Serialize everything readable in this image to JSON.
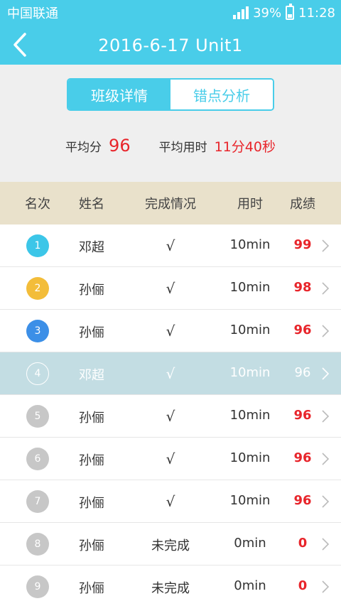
{
  "status_bar": {
    "carrier": "中国联通",
    "battery": "39%",
    "time": "11:28"
  },
  "nav": {
    "title": "2016-6-17 Unit1"
  },
  "tabs": [
    {
      "label": "班级详情",
      "active": true
    },
    {
      "label": "错点分析",
      "active": false
    }
  ],
  "summary": {
    "avg_score_label": "平均分",
    "avg_score": "96",
    "avg_time_label": "平均用时",
    "avg_time": "11分40秒"
  },
  "table": {
    "headers": {
      "rank": "名次",
      "name": "姓名",
      "status": "完成情况",
      "time": "用时",
      "score": "成绩"
    },
    "rows": [
      {
        "rank": "1",
        "name": "邓超",
        "status": "√",
        "time": "10min",
        "score": "99"
      },
      {
        "rank": "2",
        "name": "孙俪",
        "status": "√",
        "time": "10min",
        "score": "98"
      },
      {
        "rank": "3",
        "name": "孙俪",
        "status": "√",
        "time": "10min",
        "score": "96"
      },
      {
        "rank": "4",
        "name": "邓超",
        "status": "√",
        "time": "10min",
        "score": "96"
      },
      {
        "rank": "5",
        "name": "孙俪",
        "status": "√",
        "time": "10min",
        "score": "96"
      },
      {
        "rank": "6",
        "name": "孙俪",
        "status": "√",
        "time": "10min",
        "score": "96"
      },
      {
        "rank": "7",
        "name": "孙俪",
        "status": "√",
        "time": "10min",
        "score": "96"
      },
      {
        "rank": "8",
        "name": "孙俪",
        "status": "未完成",
        "time": "0min",
        "score": "0"
      },
      {
        "rank": "9",
        "name": "孙俪",
        "status": "未完成",
        "time": "0min",
        "score": "0"
      }
    ]
  },
  "colors": {
    "accent": "#49cde9",
    "score_red": "#e8252b",
    "rank1": "#3cc6e8",
    "rank2": "#f3bd3a",
    "rank3": "#3c8fe7",
    "rank_other": "#c7c7c7",
    "highlight_row": "#c3dde3",
    "table_header_bg": "#e9e1cb"
  },
  "icons": {
    "back": "chevron-left-icon",
    "row_arrow": "chevron-right-icon",
    "signal": "signal-icon",
    "battery": "battery-icon"
  }
}
